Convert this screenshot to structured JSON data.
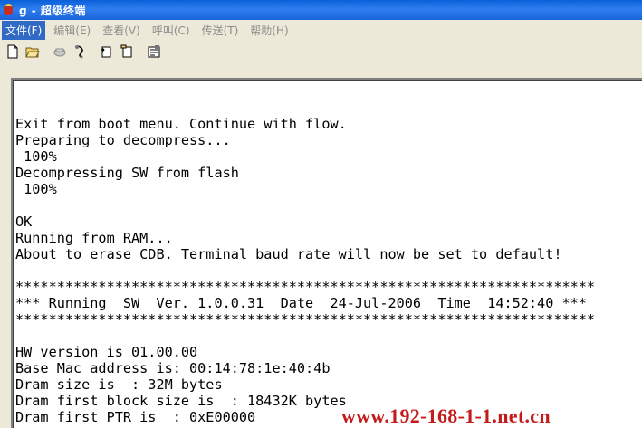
{
  "window": {
    "title": "g - 超级终端"
  },
  "menu": [
    {
      "label": "文件(F)"
    },
    {
      "label": "编辑(E)"
    },
    {
      "label": "查看(V)"
    },
    {
      "label": "呼叫(C)"
    },
    {
      "label": "传送(T)"
    },
    {
      "label": "帮助(H)"
    }
  ],
  "toolbar": [
    {
      "icon": "new-file-icon"
    },
    {
      "icon": "open-folder-icon"
    },
    {
      "icon": "connect-phone-icon"
    },
    {
      "icon": "disconnect-phone-icon"
    },
    {
      "icon": "send-icon"
    },
    {
      "icon": "receive-icon"
    },
    {
      "icon": "properties-icon"
    }
  ],
  "terminal": {
    "lines": [
      "Exit from boot menu. Continue with flow.",
      "Preparing to decompress...",
      " 100%",
      "Decompressing SW from flash",
      " 100%",
      "",
      "OK",
      "Running from RAM...",
      "About to erase CDB. Terminal baud rate will now be set to default!",
      "",
      "**********************************************************************",
      "*** Running  SW  Ver. 1.0.0.31  Date  24-Jul-2006  Time  14:52:40 ***",
      "**********************************************************************",
      "",
      "HW version is 01.00.00",
      "Base Mac address is: 00:14:78:1e:40:4b",
      "Dram size is  : 32M bytes",
      "Dram first block size is  : 18432K bytes",
      "Dram first PTR is  : 0xE00000"
    ]
  },
  "watermark": {
    "text": "www.192-168-1-1.net.cn"
  }
}
